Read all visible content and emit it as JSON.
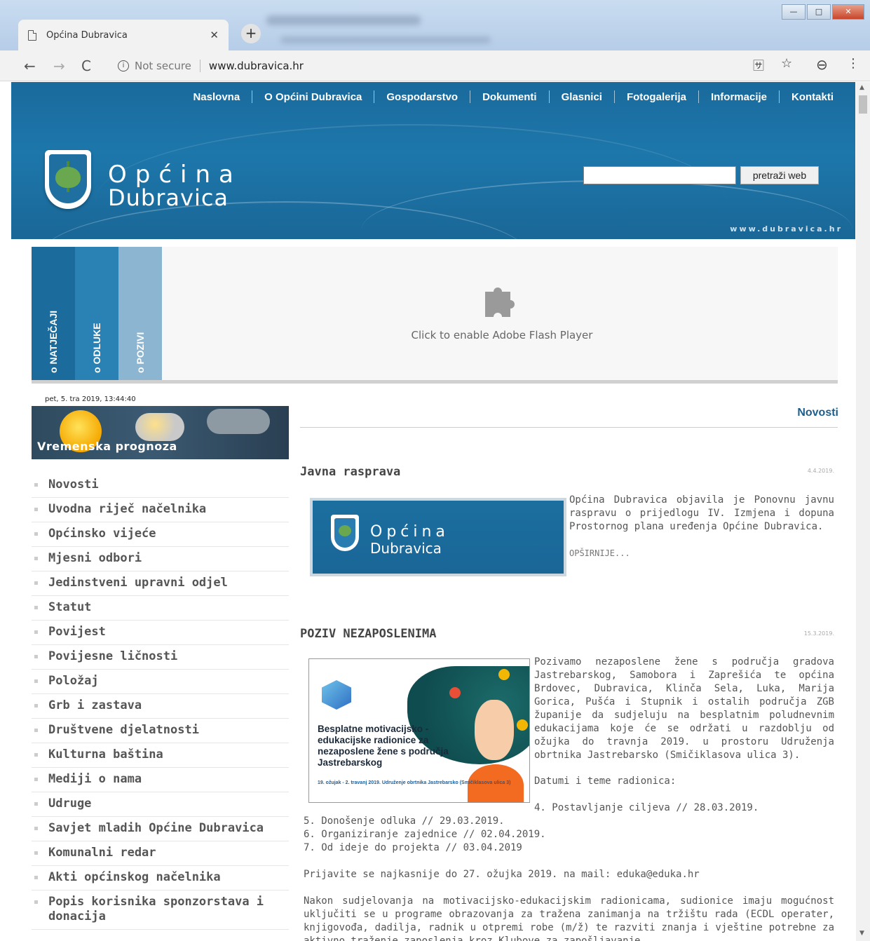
{
  "browser": {
    "tab_title": "Općina Dubravica",
    "tab_close": "✕",
    "new_tab": "+",
    "not_secure": "Not secure",
    "url": "www.dubravica.hr",
    "back": "←",
    "forward": "→",
    "reload": "C",
    "translate": "🈂",
    "star": "☆",
    "account": "⊖",
    "menu": "⋮",
    "win_min": "—",
    "win_max": "□",
    "win_close": "✕"
  },
  "header": {
    "nav": [
      "Naslovna",
      "O Općini Dubravica",
      "Gospodarstvo",
      "Dokumenti",
      "Glasnici",
      "Fotogalerija",
      "Informacije",
      "Kontakti"
    ],
    "logo_line1": "Općina",
    "logo_line2": "Dubravica",
    "search_button": "pretraži web",
    "website": "www.dubravica.hr"
  },
  "banner": {
    "tabs": [
      {
        "label": "o NATJEČAJI",
        "color": "#1b6b9c"
      },
      {
        "label": "o ODLUKE",
        "color": "#2a82b4"
      },
      {
        "label": "o POZIVI",
        "color": "#8bb5d0"
      }
    ],
    "flash_text": "Click to enable Adobe Flash Player"
  },
  "sidebar": {
    "datetime": "pet, 5. tra 2019, 13:44:40",
    "weather_title": "Vremenska prognoza",
    "menu": [
      "Novosti",
      "Uvodna riječ načelnika",
      "Općinsko vijeće",
      "Mjesni odbori",
      "Jedinstveni upravni odjel",
      "Statut",
      "Povijest",
      "Povijesne ličnosti",
      "Položaj",
      "Grb i zastava",
      "Društvene djelatnosti",
      "Kulturna baština",
      "Mediji o nama",
      "Udruge",
      "Savjet mladih Općine Dubravica",
      "Komunalni redar",
      "Akti općinskog načelnika",
      "Popis korisnika sponzorstava i donacija"
    ]
  },
  "content": {
    "section_title": "Novosti",
    "articles": [
      {
        "title": "Javna rasprava",
        "date": "4.4.2019.",
        "thumb_line1": "Općina",
        "thumb_line2": "Dubravica",
        "text": "Općina Dubravica objavila je Ponovnu javnu raspravu o prijedlogu IV. Izmjena i dopuna Prostornog plana uređenja Općine Dubravica.",
        "more": "OPŠIRNIJE..."
      },
      {
        "title": "POZIV NEZAPOSLENIMA",
        "date": "15.3.2019.",
        "poster_title": "Besplatne motivacijsko -edukacijske radionice za nezaposlene žene s područja Jastrebarskog",
        "poster_sub": "19. ožujak - 2. travanj 2019. Udruženje obrtnika Jastrebarsko (Smičiklasova ulica 3)",
        "text": "Pozivamo nezaposlene žene s područja gradova Jastrebarskog, Samobora i Zaprešića te općina Brdovec, Dubravica, Klinča Sela, Luka, Marija Gorica, Pušća i Stupnik i ostalih područja ZGB županije da sudjeluju na besplatnim poludnevnim edukacijama koje će se održati u razdoblju od ožujka do travnja 2019. u prostoru Udruženja obrtnika Jastrebarsko (Smičiklasova ulica 3).",
        "dates_heading": "Datumi i teme radionica:",
        "item4": "4. Postavljanje ciljeva // 28.03.2019.",
        "items": [
          "5. Donošenje odluka // 29.03.2019.",
          "6. Organiziranje zajednice // 02.04.2019.",
          "7. Od ideje do projekta // 03.04.2019"
        ],
        "apply": "Prijavite se najkasnije do 27. ožujka 2019. na mail: eduka@eduka.hr",
        "closing": "Nakon sudjelovanja na motivacijsko-edukacijskim radionicama, sudionice imaju mogućnost uključiti se u programe obrazovanja za tražena zanimanja na tržištu rada (ECDL operater, knjigovođa, dadilja, radnik u otpremi robe (m/ž) te razviti znanja i vještine potrebne za aktivno traženje zaposlenja kroz Klubove za zapošljavanje."
      }
    ]
  }
}
